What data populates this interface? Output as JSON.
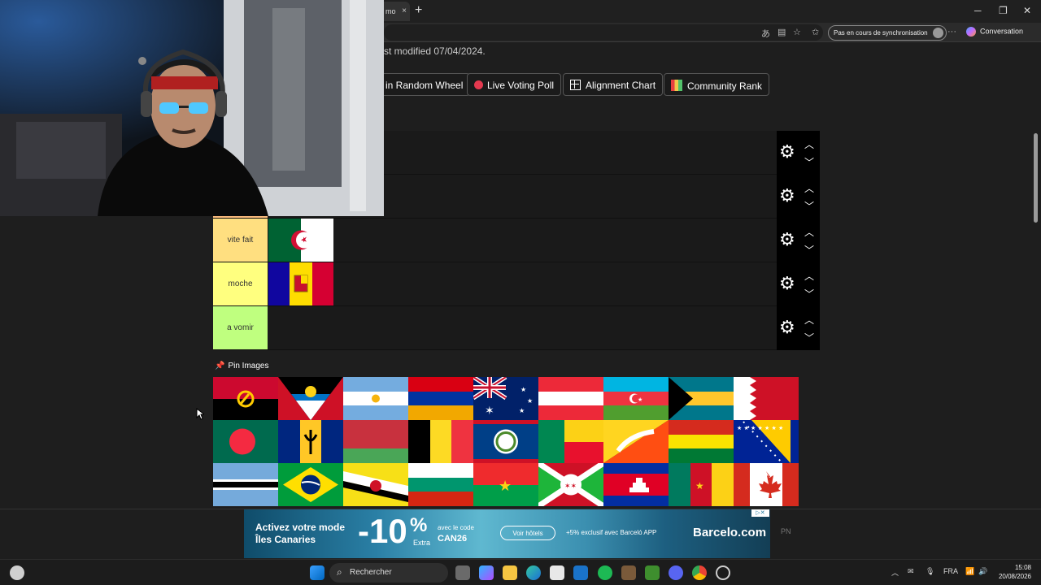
{
  "browser": {
    "tab_label": "mo",
    "close_glyph": "×",
    "new_tab_glyph": "+",
    "sync_label": "Pas en cours de synchronisation",
    "more_glyph": "···",
    "copilot_label": "Conversation"
  },
  "page": {
    "modified_text": "st modified 07/04/2024.",
    "buttons": {
      "random_wheel": "in Random Wheel",
      "live_voting": "Live Voting Poll",
      "alignment": "Alignment Chart",
      "community_rank": "Community Rank"
    },
    "tiers": [
      {
        "label": "",
        "color": "#ff7f7f"
      },
      {
        "label": "",
        "color": "#ffbf7f"
      },
      {
        "label": "vite fait",
        "color": "#ffdf80"
      },
      {
        "label": "moche",
        "color": "#ffff7f"
      },
      {
        "label": "a vomir",
        "color": "#bfff7f"
      }
    ],
    "tier_flags": {
      "vite_fait": [
        "algeria"
      ],
      "moche": [
        "andorra"
      ]
    },
    "pin_images_label": "Pin Images",
    "pool_flags": [
      "angola",
      "antigua-and-barbuda",
      "argentina",
      "armenia",
      "australia",
      "austria",
      "azerbaijan",
      "bahamas",
      "bahrain",
      "bangladesh",
      "barbados",
      "belarus",
      "belgium",
      "belize",
      "benin",
      "bhutan",
      "bolivia",
      "bosnia-and-herzegovina",
      "botswana",
      "brazil",
      "brunei",
      "bulgaria",
      "burkina-faso",
      "burundi",
      "cambodia",
      "cameroon",
      "canada"
    ]
  },
  "ad": {
    "headline_1": "Activez votre mode",
    "headline_2": "Îles Canaries",
    "discount": "-10",
    "percent": "%",
    "extra": "Extra",
    "code_label": "avec le code",
    "code": "CAN26",
    "cta": "Voir hôtels",
    "bonus": "+5% exclusif avec Barceló APP",
    "brand": "Barcelo.com",
    "side_label": "PN"
  },
  "taskbar": {
    "search_label": "Rechercher",
    "language": "FRA",
    "time": "15:08",
    "date": "20/08/2026"
  },
  "colors": {
    "accent_red": "#e5394f",
    "page_bg": "#1e1e1e",
    "tier_bg": "#1a1a1a"
  }
}
